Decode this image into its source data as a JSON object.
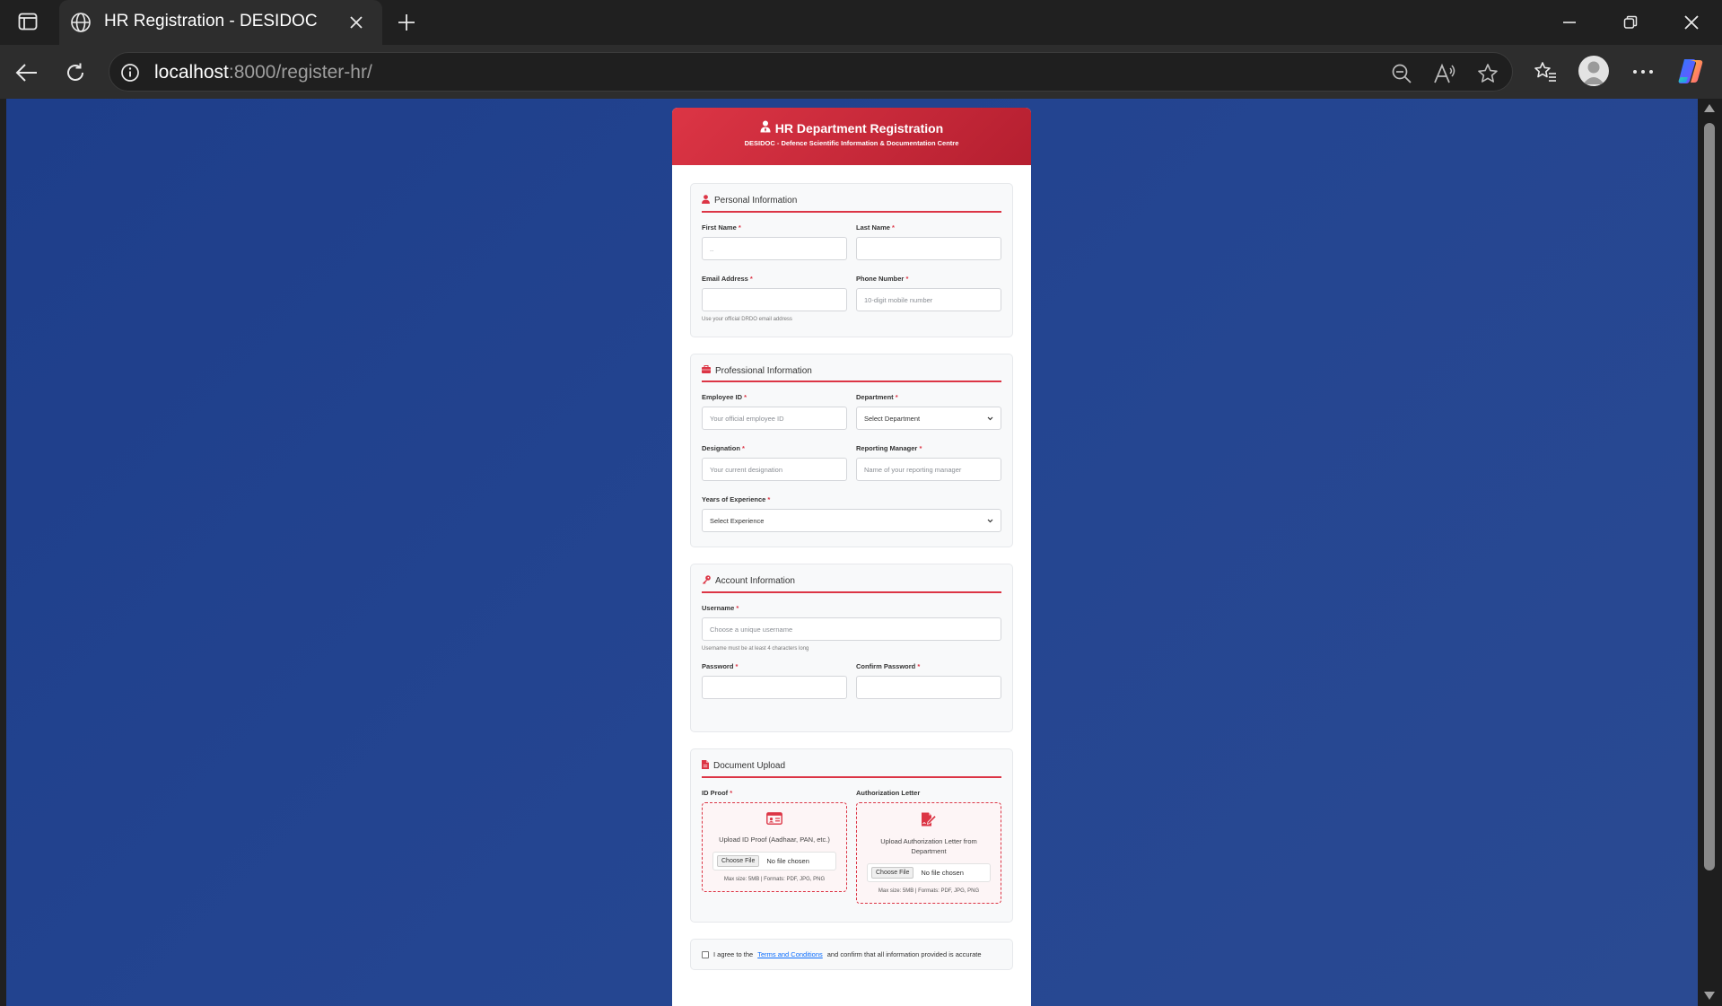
{
  "browser": {
    "tab_title": "HR Registration - DESIDOC",
    "url_host": "localhost",
    "url_rest": ":8000/register-hr/"
  },
  "header": {
    "title": "HR Department Registration",
    "subtitle": "DESIDOC - Defence Scientific Information & Documentation Centre"
  },
  "sections": {
    "personal": {
      "title": "Personal Information",
      "first_name_label": "First Name",
      "first_name_placeholder": "..",
      "last_name_label": "Last Name",
      "last_name_placeholder": "",
      "email_label": "Email Address",
      "email_placeholder": "",
      "email_hint": "Use your official DRDO email address",
      "phone_label": "Phone Number",
      "phone_placeholder": "10-digit mobile number"
    },
    "professional": {
      "title": "Professional Information",
      "employee_id_label": "Employee ID",
      "employee_id_placeholder": "Your official employee ID",
      "department_label": "Department",
      "department_value": "Select Department",
      "designation_label": "Designation",
      "designation_placeholder": "Your current designation",
      "manager_label": "Reporting Manager",
      "manager_placeholder": "Name of your reporting manager",
      "experience_label": "Years of Experience",
      "experience_value": "Select Experience"
    },
    "account": {
      "title": "Account Information",
      "username_label": "Username",
      "username_placeholder": "Choose a unique username",
      "username_hint": "Username must be at least 4 characters long",
      "password_label": "Password",
      "confirm_label": "Confirm Password"
    },
    "documents": {
      "title": "Document Upload",
      "id_proof_label": "ID Proof",
      "id_proof_text": "Upload ID Proof (Aadhaar, PAN, etc.)",
      "auth_label": "Authorization Letter",
      "auth_text": "Upload Authorization Letter from Department",
      "choose_file": "Choose File",
      "no_file": "No file chosen",
      "meta": "Max size: 5MB | Formats: PDF, JPG, PNG"
    }
  },
  "terms": {
    "prefix": "I agree to the",
    "link": "Terms and Conditions",
    "suffix": "and confirm that all information provided is accurate"
  },
  "required_mark": "*",
  "colors": {
    "accent": "#dc3545",
    "background": "#1e3e8a",
    "link": "#0d6efd"
  }
}
